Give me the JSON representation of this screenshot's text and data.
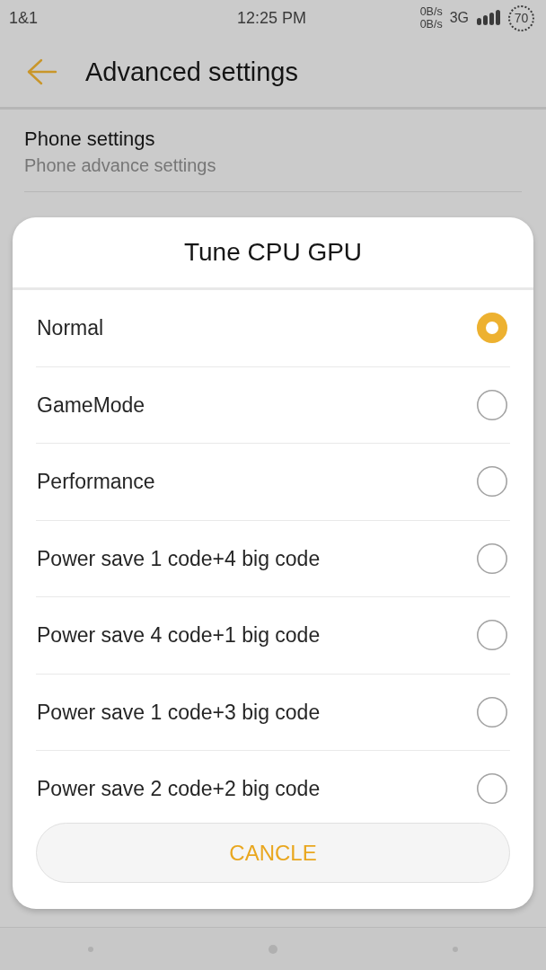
{
  "status_bar": {
    "carrier": "1&1",
    "time": "12:25 PM",
    "net_speed": [
      "0B/s",
      "0B/s"
    ],
    "network": "3G",
    "battery": "70"
  },
  "app_bar": {
    "title": "Advanced settings"
  },
  "settings": [
    {
      "title": "Phone settings",
      "subtitle": "Phone advance settings"
    }
  ],
  "dialog": {
    "title": "Tune CPU GPU",
    "options": [
      {
        "label": "Normal",
        "selected": true
      },
      {
        "label": "GameMode",
        "selected": false
      },
      {
        "label": "Performance",
        "selected": false
      },
      {
        "label": "Power save 1 code+4 big code",
        "selected": false
      },
      {
        "label": "Power save 4 code+1 big code",
        "selected": false
      },
      {
        "label": "Power save 1 code+3 big code",
        "selected": false
      },
      {
        "label": "Power save 2 code+2 big code",
        "selected": false
      }
    ],
    "button": "CANCLE"
  }
}
